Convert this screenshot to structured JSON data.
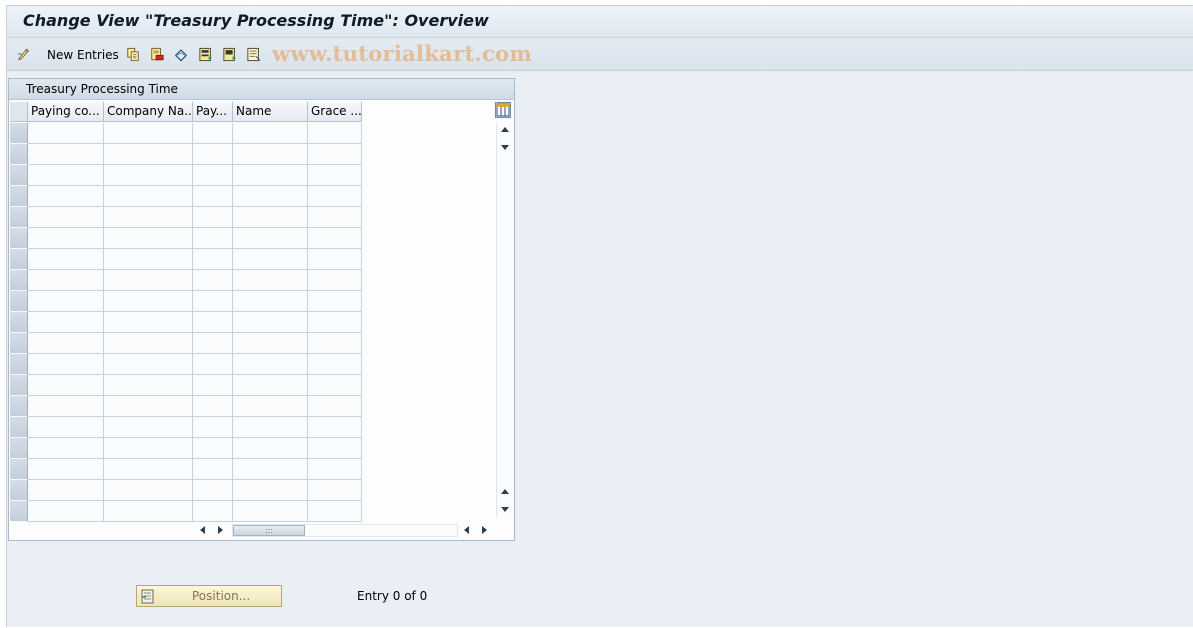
{
  "window": {
    "title": "Change View \"Treasury Processing Time\": Overview"
  },
  "toolbar": {
    "new_entries_label": "New Entries",
    "watermark": "www.tutorialkart.com",
    "icons": [
      "edit-pen-icon",
      "copy-icon",
      "delete-icon",
      "undo-change-icon",
      "select-all-icon",
      "select-block-icon",
      "deselect-all-icon"
    ]
  },
  "table": {
    "caption": "Treasury Processing Time",
    "columns": [
      "Paying co...",
      "Company Na...",
      "Pay...",
      "Name",
      "Grace ..."
    ],
    "row_count": 19
  },
  "footer": {
    "position_button_label": "Position...",
    "entry_counter": "Entry 0 of 0"
  }
}
